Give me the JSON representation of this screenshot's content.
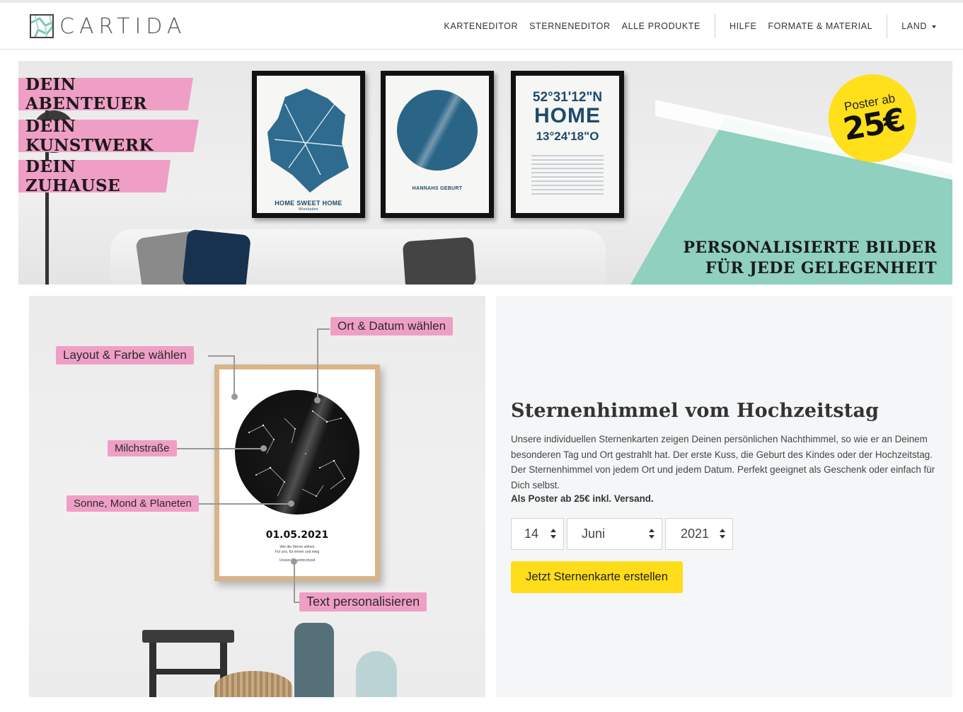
{
  "brand": {
    "logo_text": "CARTIDA"
  },
  "nav": {
    "items": [
      "KARTENEDITOR",
      "STERNENEDITOR",
      "ALLE PRODUKTE"
    ],
    "help_items": [
      "HILFE",
      "FORMATE & MATERIAL"
    ],
    "country": "LAND"
  },
  "hero": {
    "taglines": [
      "DEIN ABENTEUER",
      "DEIN KUNSTWERK",
      "DEIN ZUHAUSE"
    ],
    "poster1": {
      "caption": "HOME SWEET HOME",
      "sub": "Wiesbaden"
    },
    "poster2": {
      "caption": "HANNAHS GEBURT"
    },
    "poster3": {
      "lat": "52°31'12\"N",
      "word": "HOME",
      "lon": "13°24'18\"O"
    },
    "badge": {
      "prefix": "Poster ab",
      "price": "25€"
    },
    "claim_line1": "PERSONALISIERTE BILDER",
    "claim_line2": "FÜR JEDE GELEGENHEIT",
    "colors": {
      "pink": "#ef9fc6",
      "mint": "#8fd0bf",
      "yellow": "#ffe01a"
    }
  },
  "feature": {
    "callouts": {
      "ort": "Ort & Datum wählen",
      "layout": "Layout & Farbe wählen",
      "milchstrasse": "Milchstraße",
      "sonne": "Sonne, Mond & Planeten",
      "text": "Text personalisieren"
    },
    "poster_date": "01.05.2021",
    "poster_sub1": "Wie die Sterne stehen",
    "poster_sub2": "Für uns, für immer und ewig",
    "poster_sub3": "Unsere Traumhochzeit"
  },
  "panel": {
    "title": "Sternenhimmel vom Hochzeitstag",
    "text": "Unsere individuellen Sternenkarten zeigen Deinen persönlichen Nachthimmel, so wie er an Deinem besonderen Tag und Ort gestrahlt hat. Der erste Kuss, die Geburt des Kindes oder der Hochzeitstag. Der Sternenhimmel von jedem Ort und jedem Datum. Perfekt geeignet als Geschenk oder einfach für Dich selbst.",
    "price_note": "Als Poster ab 25€ inkl. Versand.",
    "day": "14",
    "month": "Juni",
    "year": "2021",
    "cta": "Jetzt Sternenkarte erstellen"
  }
}
